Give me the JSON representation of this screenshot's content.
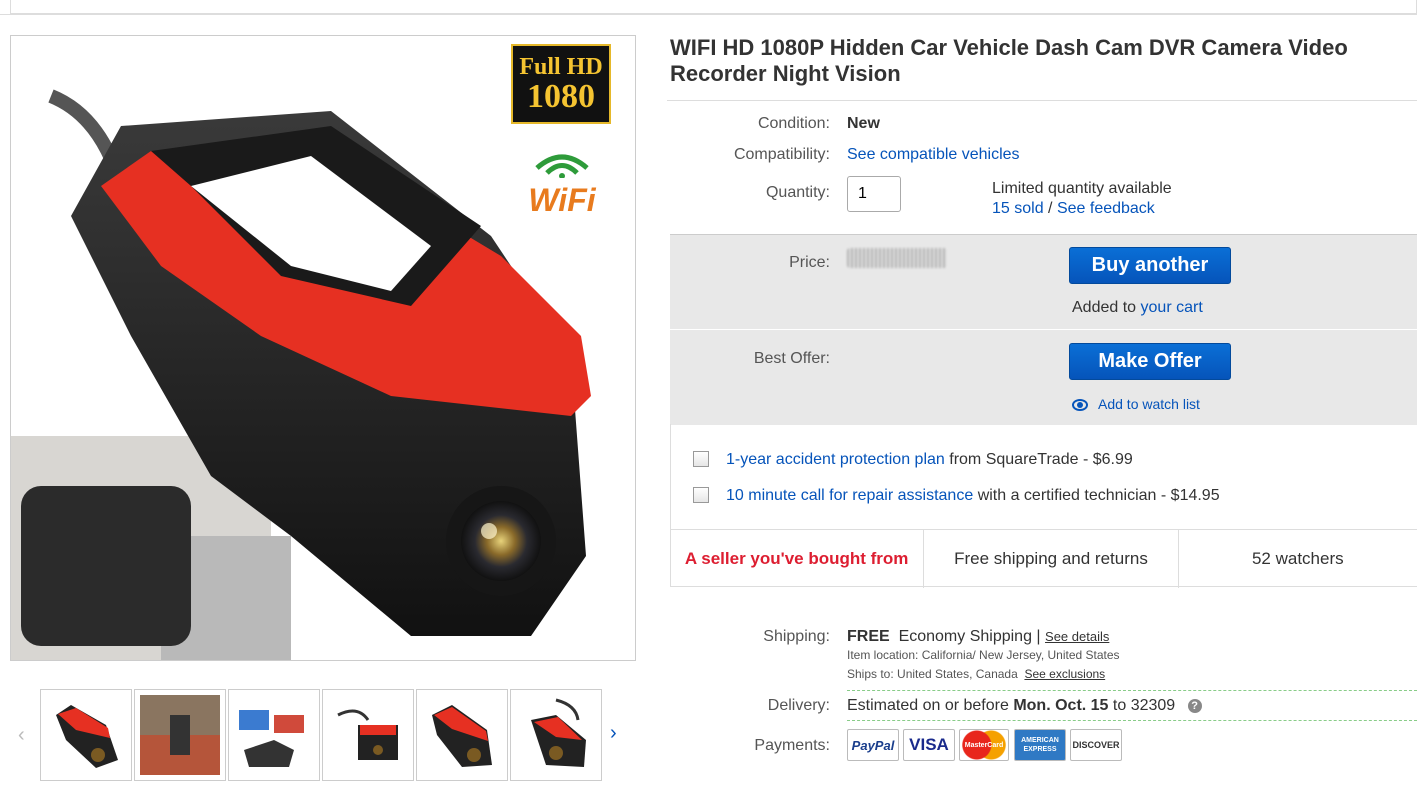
{
  "product": {
    "title": "WIFI HD 1080P Hidden Car Vehicle Dash Cam DVR Camera Video Recorder Night Vision",
    "badge_fullhd_top": "Full HD",
    "badge_fullhd_bottom": "1080",
    "badge_wifi": "WiFi"
  },
  "details": {
    "condition_label": "Condition:",
    "condition_value": "New",
    "compat_label": "Compatibility:",
    "compat_link": "See compatible vehicles",
    "qty_label": "Quantity:",
    "qty_value": "1",
    "limited": "Limited quantity available",
    "sold_link": "15 sold",
    "separator": "/",
    "feedback_link": "See feedback"
  },
  "price": {
    "label": "Price:",
    "buy_button": "Buy another",
    "added_text": "Added to",
    "cart_link": "your cart",
    "best_offer_label": "Best Offer:",
    "offer_button": "Make Offer",
    "watch_link": "Add to watch list"
  },
  "addons": [
    {
      "link": "1-year accident protection plan",
      "text": "from SquareTrade - $6.99"
    },
    {
      "link": "10 minute call for repair assistance",
      "text": "with a certified technician - $14.95"
    }
  ],
  "signals": {
    "seller": "A seller you've bought from",
    "shipping": "Free shipping and returns",
    "watchers": "52 watchers"
  },
  "shipping": {
    "label": "Shipping:",
    "free": "FREE",
    "method": "Economy Shipping |",
    "details_link": "See details",
    "location": "Item location:  California/ New Jersey, United States",
    "ships_to": "Ships to:  United States, Canada",
    "exclusions_link": "See exclusions",
    "delivery_label": "Delivery:",
    "delivery_prefix": "Estimated on or before",
    "delivery_date": "Mon. Oct. 15",
    "delivery_suffix": "to 32309",
    "help": "?",
    "payments_label": "Payments:"
  },
  "payments": [
    "PayPal",
    "VISA",
    "MasterCard",
    "AMERICAN EXPRESS",
    "DISCOVER"
  ],
  "nav": {
    "prev": "‹",
    "next": "›"
  }
}
